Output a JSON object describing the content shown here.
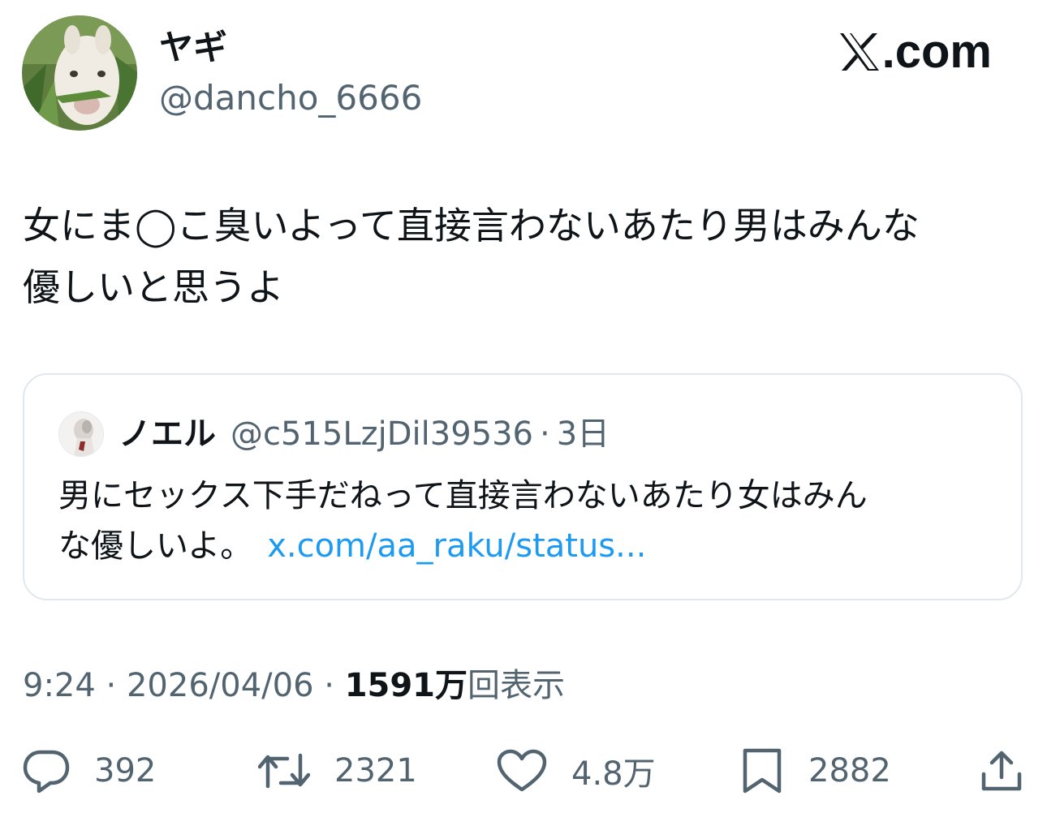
{
  "author": {
    "display_name": "ヤギ",
    "handle": "@dancho_6666"
  },
  "brand": {
    "label": ".com"
  },
  "tweet": {
    "line1": "女にま◯こ臭いよって直接言わないあたり男はみんな",
    "line2": "優しいと思うよ"
  },
  "quote": {
    "display_name": "ノエル",
    "handle": "@c515LzjDil39536",
    "separator": "·",
    "time": "3日",
    "line1": "男にセックス下手だねって直接言わないあたり女はみん",
    "line2": "な優しいよ。",
    "link": "x.com/aa_raku/status..."
  },
  "meta": {
    "time": "9:24",
    "sep1": " · ",
    "date": "2026/04/06",
    "sep2": " · ",
    "views_count": "1591万",
    "views_label": "回表示"
  },
  "actions": {
    "reply_count": "392",
    "retweet_count": "2321",
    "like_count": "4.8万",
    "bookmark_count": "2882"
  },
  "colors": {
    "text": "#0f1419",
    "secondary": "#536471",
    "link": "#1d9bf0",
    "border": "#e1e8ed"
  }
}
